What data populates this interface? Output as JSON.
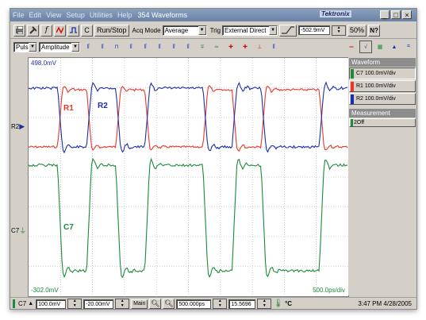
{
  "menu": {
    "items": [
      "File",
      "Edit",
      "View",
      "Setup",
      "Utilities",
      "Help"
    ],
    "title": "354 Waveforms"
  },
  "brand": "Tektronix",
  "window_buttons": {
    "minimize": "_",
    "maximize": "□",
    "close": "×"
  },
  "toolbar1": {
    "c_label": "C",
    "run_stop": "Run/Stop",
    "acq_mode_label": "Acq Mode",
    "acq_mode_value": "Average",
    "trig_label": "Trig",
    "trig_value": "External Direct",
    "trig_level": "-502.9mV",
    "zoom": "50%",
    "help": "N?"
  },
  "toolbar2": {
    "measure_category": "Pulse",
    "measure_type": "Amplitude",
    "tool_icons": [
      "pulse-width-icon",
      "period-icon",
      "duty-cycle-icon",
      "burst-icon",
      "rise-fall-icon",
      "cross-icon",
      "phase-icon",
      "overshoot-icon",
      "mean-icon",
      "rms-icon",
      "jitter-icon",
      "cursor-icon",
      "histogram-icon",
      "mask-icon"
    ]
  },
  "scope": {
    "top_label": "498.0mV",
    "bottom_label": "-302.0mV",
    "timebase_label": "500.0ps/div",
    "labels": {
      "r1": "R1",
      "r2": "R2",
      "c7": "C7"
    },
    "markers": {
      "r2": "R2",
      "c7": "C7"
    }
  },
  "colors": {
    "c7": "#1e8a3a",
    "r1": "#e8362a",
    "r2": "#1c2fa8",
    "panel_head": "#8c8c8c"
  },
  "panel": {
    "waveform_title": "Waveform",
    "waveforms": [
      {
        "label": "C7 100.0mV/div",
        "color": "#1e8a3a"
      },
      {
        "label": "R1 100.0mV/div",
        "color": "#e8362a"
      },
      {
        "label": "R2 100.0mV/div",
        "color": "#1c2fa8"
      }
    ],
    "measurement_title": "Measurement",
    "measurement_value": "Off",
    "measurement_index": "2"
  },
  "bottom": {
    "channel": "C7",
    "scale": "100.0mV",
    "offset": "-20.00mV",
    "main_label": "Main",
    "horizontal_pos": "500.000ps",
    "temp": "15.5696",
    "temp_unit": "°C",
    "timestamp": "3:47 PM 4/28/2005"
  }
}
